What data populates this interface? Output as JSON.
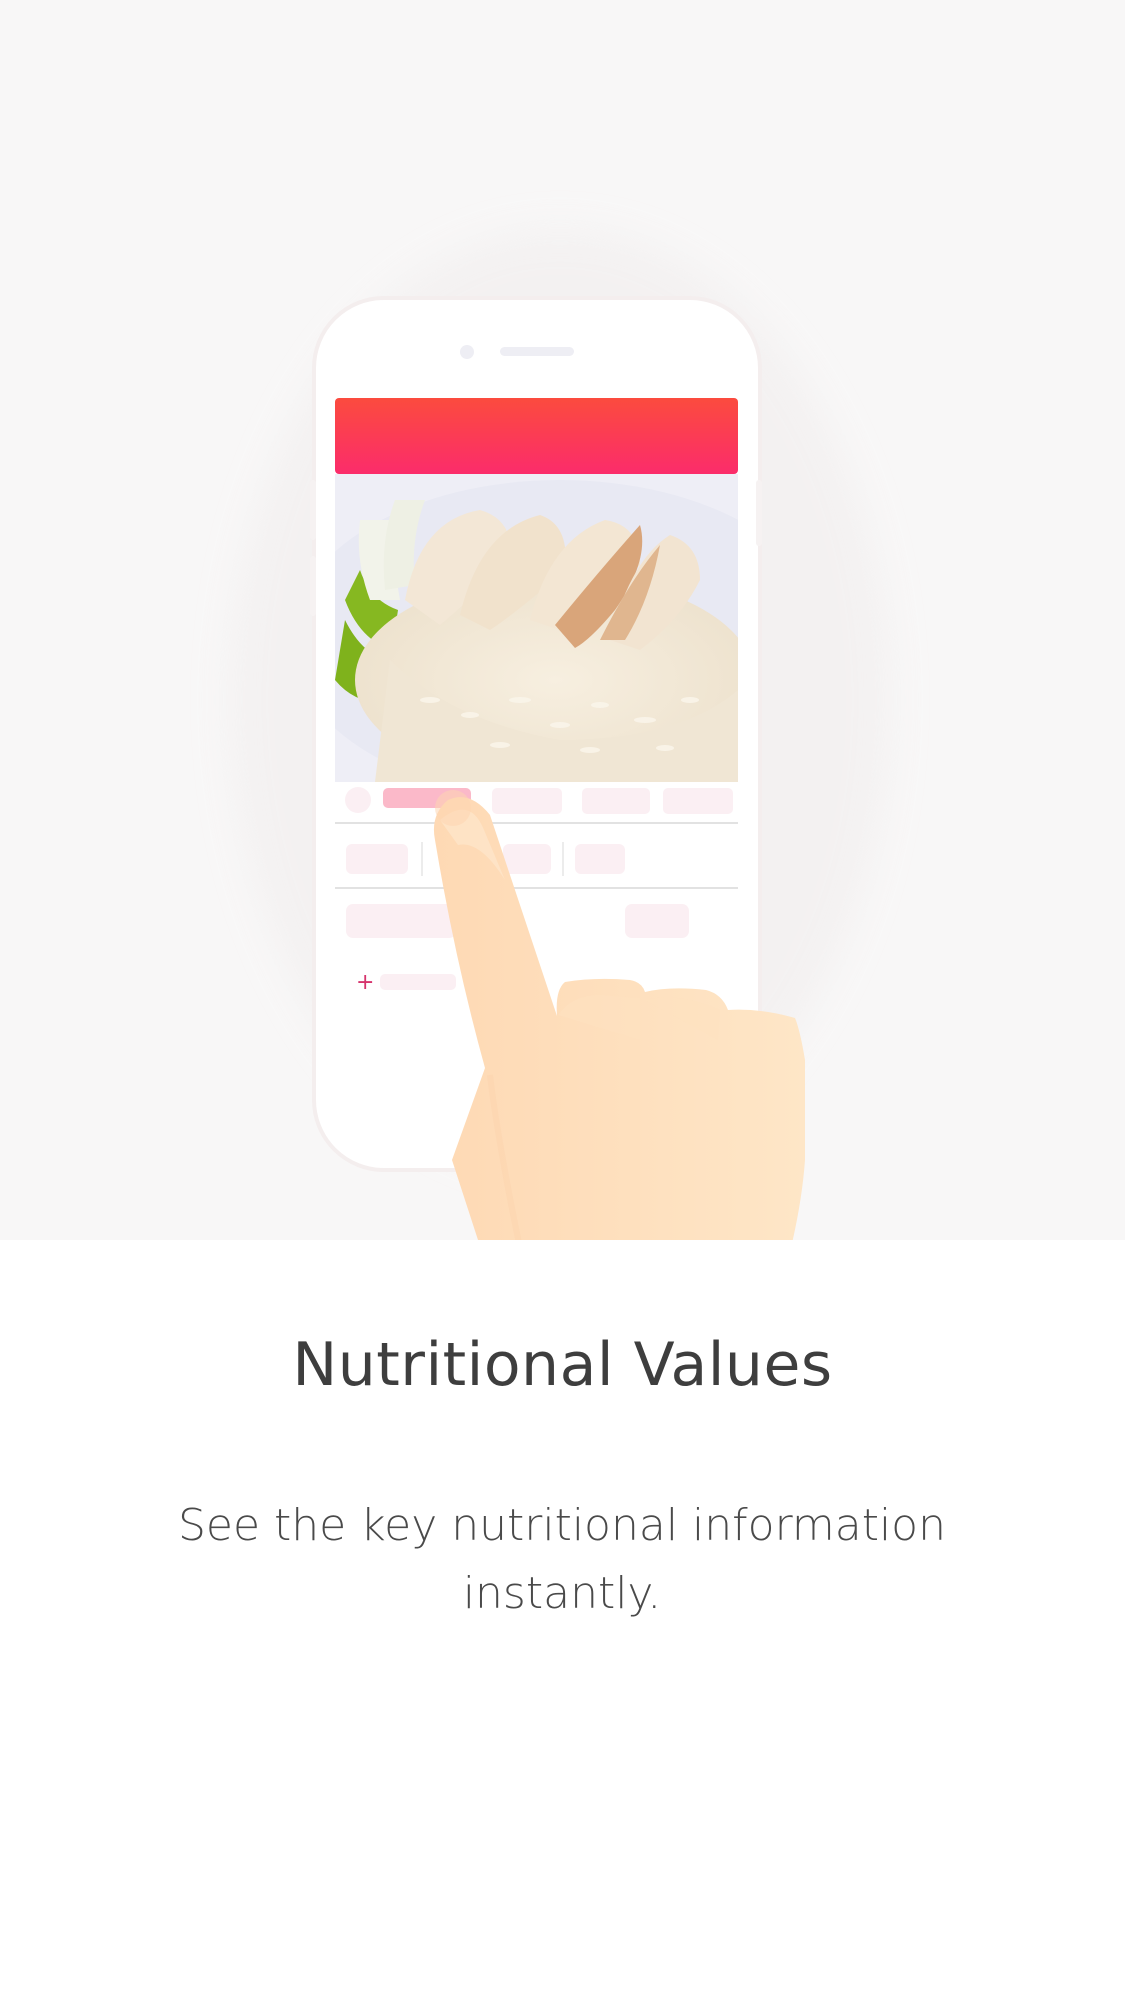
{
  "onboarding": {
    "title": "Nutritional Values",
    "description": "See the key nutritional information instantly."
  },
  "colors": {
    "hero_background": "#f8f7f7",
    "header_gradient_top": "#fb4b3e",
    "header_gradient_bottom": "#fb2c6b",
    "title_text": "#3e3e3e",
    "body_text": "#4a4a4a",
    "skin": "#fee0bd"
  },
  "icons": {
    "plus": "+"
  }
}
